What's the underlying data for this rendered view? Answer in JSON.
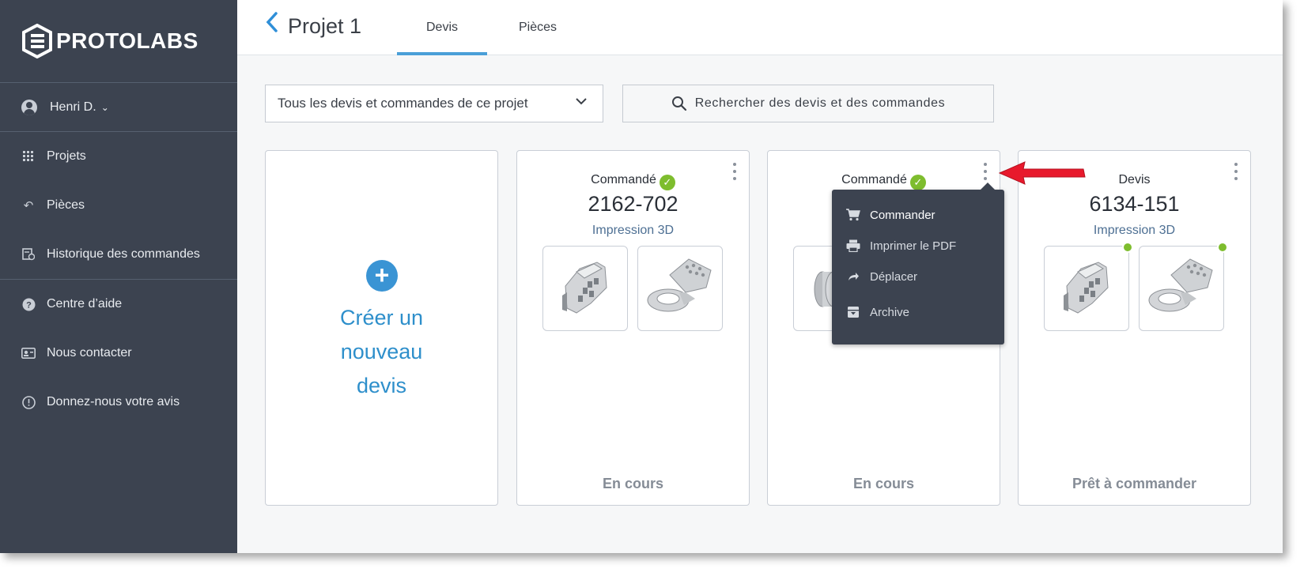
{
  "brand": {
    "name": "PROTOLABS"
  },
  "sidebar": {
    "user": {
      "name": "Henri D."
    },
    "items": [
      {
        "label": "Projets",
        "icon": "grid-icon"
      },
      {
        "label": "Pièces",
        "icon": "undo-icon"
      },
      {
        "label": "Historique des commandes",
        "icon": "order-history-icon"
      },
      {
        "label": "Centre d’aide",
        "icon": "help-icon"
      },
      {
        "label": "Nous contacter",
        "icon": "contact-card-icon"
      },
      {
        "label": "Donnez-nous votre avis",
        "icon": "feedback-icon"
      }
    ]
  },
  "header": {
    "project_title": "Projet 1",
    "tabs": [
      {
        "label": "Devis",
        "active": true
      },
      {
        "label": "Pièces",
        "active": false
      }
    ]
  },
  "toolbar": {
    "filter_value": "Tous les devis et commandes de ce projet",
    "search_placeholder": "Rechercher des devis et des commandes"
  },
  "create_card": {
    "label": "Créer un nouveau devis"
  },
  "cards": [
    {
      "status": "Commandé",
      "number": "2162-702",
      "process": "Impression 3D",
      "footer": "En cours"
    },
    {
      "status": "Commandé",
      "number": "",
      "process": "",
      "footer": "En cours"
    },
    {
      "status": "Devis",
      "number": "6134-151",
      "process": "Impression 3D",
      "footer": "Prêt à commander"
    }
  ],
  "menu": {
    "items": [
      {
        "label": "Commander",
        "icon": "cart-icon"
      },
      {
        "label": "Imprimer le PDF",
        "icon": "printer-icon"
      },
      {
        "label": "Déplacer",
        "icon": "move-arrow-icon"
      },
      {
        "label": "Archive",
        "icon": "archive-icon"
      }
    ]
  },
  "colors": {
    "sidebar_bg": "#3c4350",
    "accent_blue": "#2e8fcb",
    "status_green": "#7ebd2e",
    "annotation_red": "#e8192c"
  }
}
